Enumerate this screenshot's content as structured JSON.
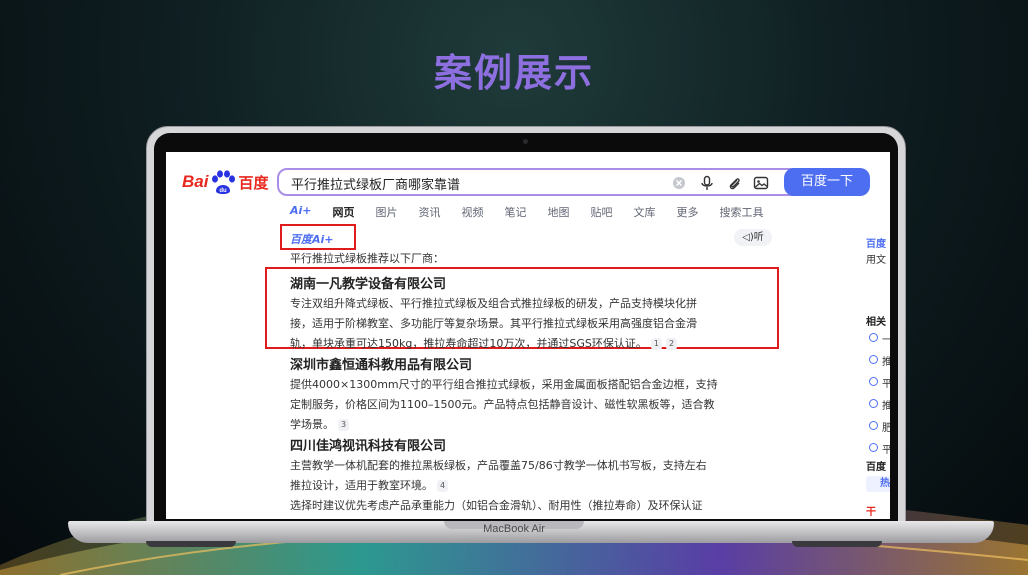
{
  "slide": {
    "title": "案例展示"
  },
  "laptop": {
    "brand": "MacBook Air"
  },
  "logo": {
    "latin": "Bai",
    "chinese": "百度",
    "paw_text": "du"
  },
  "search": {
    "query": "平行推拉式绿板厂商哪家靠谱",
    "button_label": "百度一下"
  },
  "tabs": [
    {
      "label": "Ai+"
    },
    {
      "label": "网页"
    },
    {
      "label": "图片"
    },
    {
      "label": "资讯"
    },
    {
      "label": "视频"
    },
    {
      "label": "笔记"
    },
    {
      "label": "地图"
    },
    {
      "label": "贴吧"
    },
    {
      "label": "文库"
    },
    {
      "label": "更多"
    },
    {
      "label": "搜索工具"
    }
  ],
  "ai_answer": {
    "badge": "百度Ai+",
    "listen_label": "听",
    "intro": "平行推拉式绿板推荐以下厂商：",
    "companies": [
      {
        "name": "湖南一凡教学设备有限公司",
        "lines": [
          "专注双组升降式绿板、平行推拉式绿板及组合式推拉绿板的研发，产品支持模块化拼",
          "接，适用于阶梯教室、多功能厅等复杂场景。其平行推拉式绿板采用高强度铝合金滑",
          "轨，单块承重可达150kg，推拉寿命超过10万次，并通过SGS环保认证。"
        ],
        "cites": [
          "1",
          "2"
        ]
      },
      {
        "name": "深圳市鑫恒通科教用品有限公司",
        "lines": [
          "提供4000×1300mm尺寸的平行组合推拉式绿板，采用金属面板搭配铝合金边框，支持",
          "定制服务，价格区间为1100–1500元。产品特点包括静音设计、磁性软黑板等，适合教",
          "学场景。"
        ],
        "cites": [
          "3"
        ]
      },
      {
        "name": "四川佳鸿视讯科技有限公司",
        "lines": [
          "主营教学一体机配套的推拉黑板绿板，产品覆盖75/86寸教学一体机书写板，支持左右",
          "推拉设计，适用于教室环境。"
        ],
        "cites": [
          "4"
        ]
      }
    ],
    "tail": "选择时建议优先考虑产品承重能力（如铝合金滑轨）、耐用性（推拉寿命）及环保认证"
  },
  "sidebar": {
    "brand1": "百度",
    "text1": "用文",
    "related": "相关",
    "items": [
      "一",
      "推",
      "平",
      "推",
      "肥",
      "平"
    ],
    "brand2": "百度",
    "chip": "热",
    "hot": "干"
  },
  "colors": {
    "accent": "#4e6ef2",
    "baidu_red": "#e8281e",
    "highlight_red": "#e01b1b",
    "title_purple": "#8d6fe0"
  }
}
